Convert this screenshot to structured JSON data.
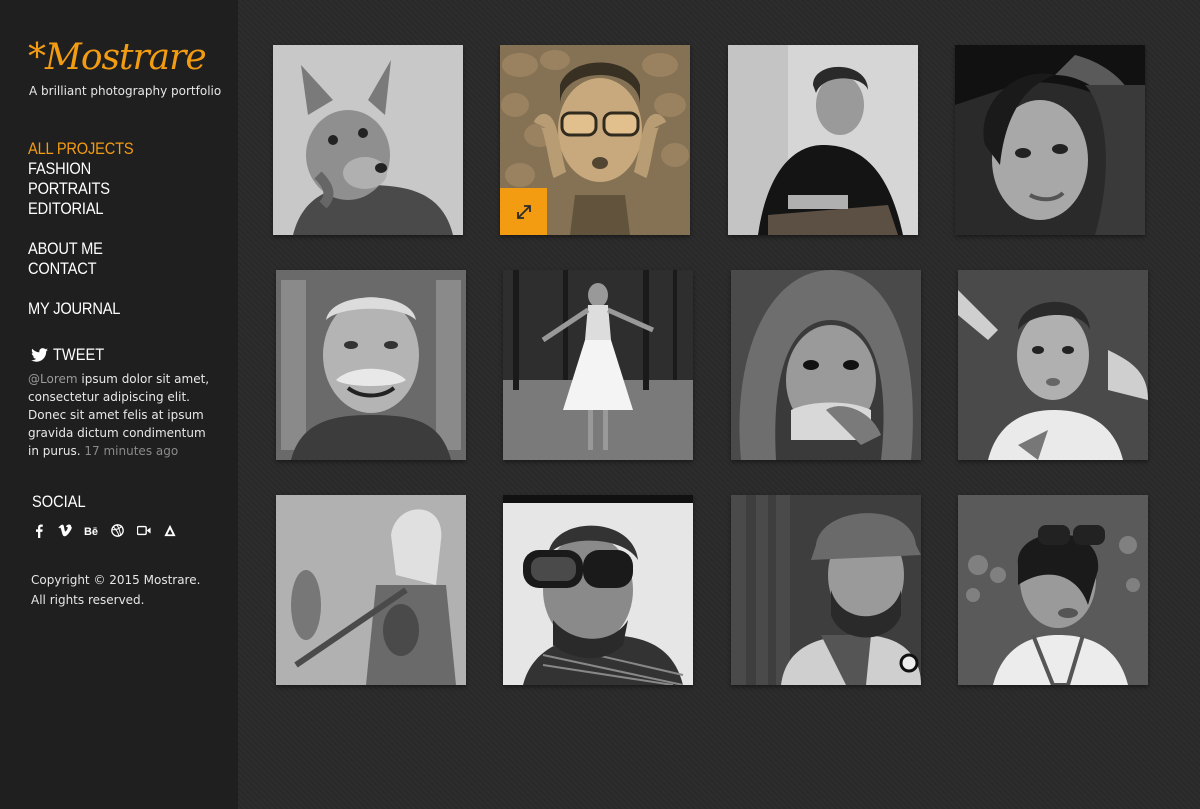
{
  "brand": {
    "logo": "*Mostrare",
    "tagline": "A brilliant photography portfolio",
    "accent": "#f39c12"
  },
  "nav": {
    "group1": [
      "ALL PROJECTS",
      "FASHION",
      "PORTRAITS",
      "EDITORIAL"
    ],
    "group2": [
      "ABOUT ME",
      "CONTACT"
    ],
    "group3": [
      "MY JOURNAL"
    ]
  },
  "tweet": {
    "heading": "TWEET",
    "handle": "@Lorem",
    "text": " ipsum dolor sit amet, consectetur adipiscing elit. Donec sit amet felis at ipsum gravida dictum condimentum in purus. ",
    "time": "17 minutes ago"
  },
  "social": {
    "heading": "SOCIAL",
    "icons": [
      "facebook-icon",
      "vimeo-icon",
      "behance-icon",
      "dribbble-icon",
      "video-icon",
      "vine-icon"
    ]
  },
  "copyright": {
    "line1": "Copyright © 2015 Mostrare.",
    "line2": "All rights reserved."
  },
  "gallery": [
    {
      "name": "fox-mask-portrait"
    },
    {
      "name": "woman-sunglasses-stones",
      "hovered": true
    },
    {
      "name": "man-seated-chair"
    },
    {
      "name": "woman-hat-portrait"
    },
    {
      "name": "old-man-mustache"
    },
    {
      "name": "woman-white-dress"
    },
    {
      "name": "hooded-old-man"
    },
    {
      "name": "young-man-pointing"
    },
    {
      "name": "girl-violin"
    },
    {
      "name": "man-goggles"
    },
    {
      "name": "man-hat-beard"
    },
    {
      "name": "woman-sunglasses-head"
    }
  ]
}
